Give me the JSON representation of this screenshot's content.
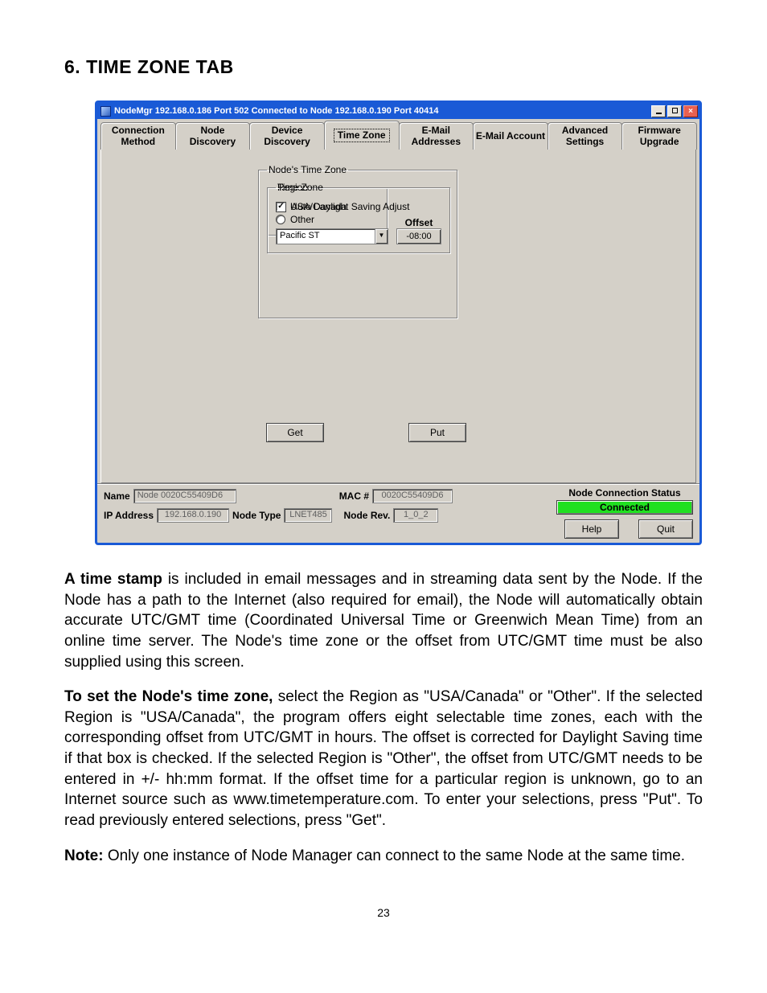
{
  "heading": "6.  TIME ZONE TAB",
  "window": {
    "title": "NodeMgr 192.168.0.186 Port 502  Connected to  Node 192.168.0.190 Port 40414",
    "tabs": [
      "Connection Method",
      "Node Discovery",
      "Device Discovery",
      "Time Zone",
      "E-Mail Addresses",
      "E-Mail Account",
      "Advanced Settings",
      "Firmware Upgrade"
    ],
    "active_tab_index": 3,
    "group_outer_legend": "Node's Time Zone",
    "region": {
      "legend": "Region",
      "options": [
        "USA/Canada",
        "Other"
      ],
      "selected_index": 0
    },
    "timezone": {
      "legend": "Time Zone",
      "auto_dst_label": "Auto Daylight Saving Adjust",
      "auto_dst_checked": true,
      "combo_value": "Pacific ST",
      "offset_label": "Offset",
      "offset_value": "-08:00"
    },
    "buttons": {
      "get": "Get",
      "put": "Put"
    },
    "status": {
      "name_label": "Name",
      "name_value": "Node 0020C55409D6",
      "mac_label": "MAC #",
      "mac_value": "0020C55409D6",
      "ip_label": "IP Address",
      "ip_value": "192.168.0.190",
      "nodetype_label": "Node Type",
      "nodetype_value": "LNET485",
      "noderev_label": "Node Rev.",
      "noderev_value": "1_0_2",
      "conn_title": "Node Connection Status",
      "conn_value": "Connected",
      "help": "Help",
      "quit": "Quit"
    }
  },
  "paragraphs": {
    "p1_strong": "A time stamp",
    "p1_rest": " is included in email messages and in streaming data sent by the Node. If the Node has a path to the Internet (also required for email), the Node will automatically obtain accurate UTC/GMT time (Coordinated Universal Time or Greenwich Mean Time) from an online time server. The Node's time zone or the offset from UTC/GMT time must be also supplied using this screen.",
    "p2_strong": "To set the Node's time zone,",
    "p2_rest": " select the Region as \"USA/Canada\" or \"Other\". If the selected Region is \"USA/Canada\", the program offers eight selectable time zones, each with the corresponding offset from UTC/GMT in hours. The offset is corrected for Daylight Saving time if that box is checked. If the selected Region is \"Other\", the offset from UTC/GMT needs to be entered in +/- hh:mm format. If the offset time for a particular region is unknown, go to an Internet source such as www.timetemperature.com. To enter your selections, press \"Put\". To read previously entered selections, press \"Get\".",
    "p3_strong": "Note:",
    "p3_rest": " Only one instance of Node Manager can connect to the same Node at the same time."
  },
  "page_number": "23"
}
